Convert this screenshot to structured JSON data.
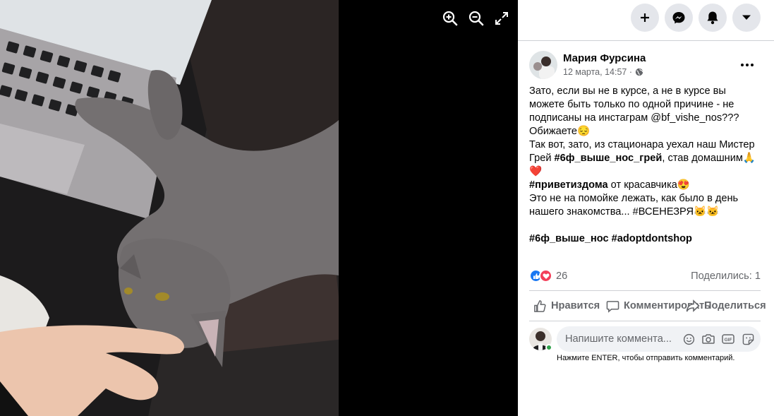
{
  "viewer": {
    "tools": {
      "zoom_in": "zoom-in-icon",
      "zoom_out": "zoom-out-icon",
      "fullscreen": "fullscreen-icon"
    }
  },
  "header_buttons": [
    "plus-icon",
    "messenger-icon",
    "bell-icon",
    "caret-down-icon"
  ],
  "post": {
    "author": "Мария Фурсина",
    "date": "12 марта, 14:57 ·",
    "text_lines": [
      "Зато, если вы не в курсе, а не в курсе вы",
      "можете быть только по одной причине - не",
      "подписаны на инстаграм @bf_vishe_nos???",
      "Обижаете😔",
      "Так вот, зато, из стационара уехал наш Мистер",
      "Грей",
      "#6ф_выше_нос_грей",
      ", став домашним🙏",
      "❤️",
      "#приветиздома",
      " от красавчика😍",
      "Это не на помойке лежать, как было в день",
      "нашего знакомства... #ВСЕНЕЗРЯ🐱🐱",
      "#6ф_выше_нос #adoptdontshop"
    ]
  },
  "reactions": {
    "count": "26",
    "shares": "Поделились: 1"
  },
  "actions": {
    "like": "Нравится",
    "comment": "Комментировать",
    "share": "Поделиться"
  },
  "comment": {
    "placeholder": "Напишите коммента...",
    "hint": "Нажмите ENTER, чтобы отправить комментарий.",
    "icons": [
      "smiley-icon",
      "camera-icon",
      "gif-icon",
      "sticker-icon"
    ]
  }
}
